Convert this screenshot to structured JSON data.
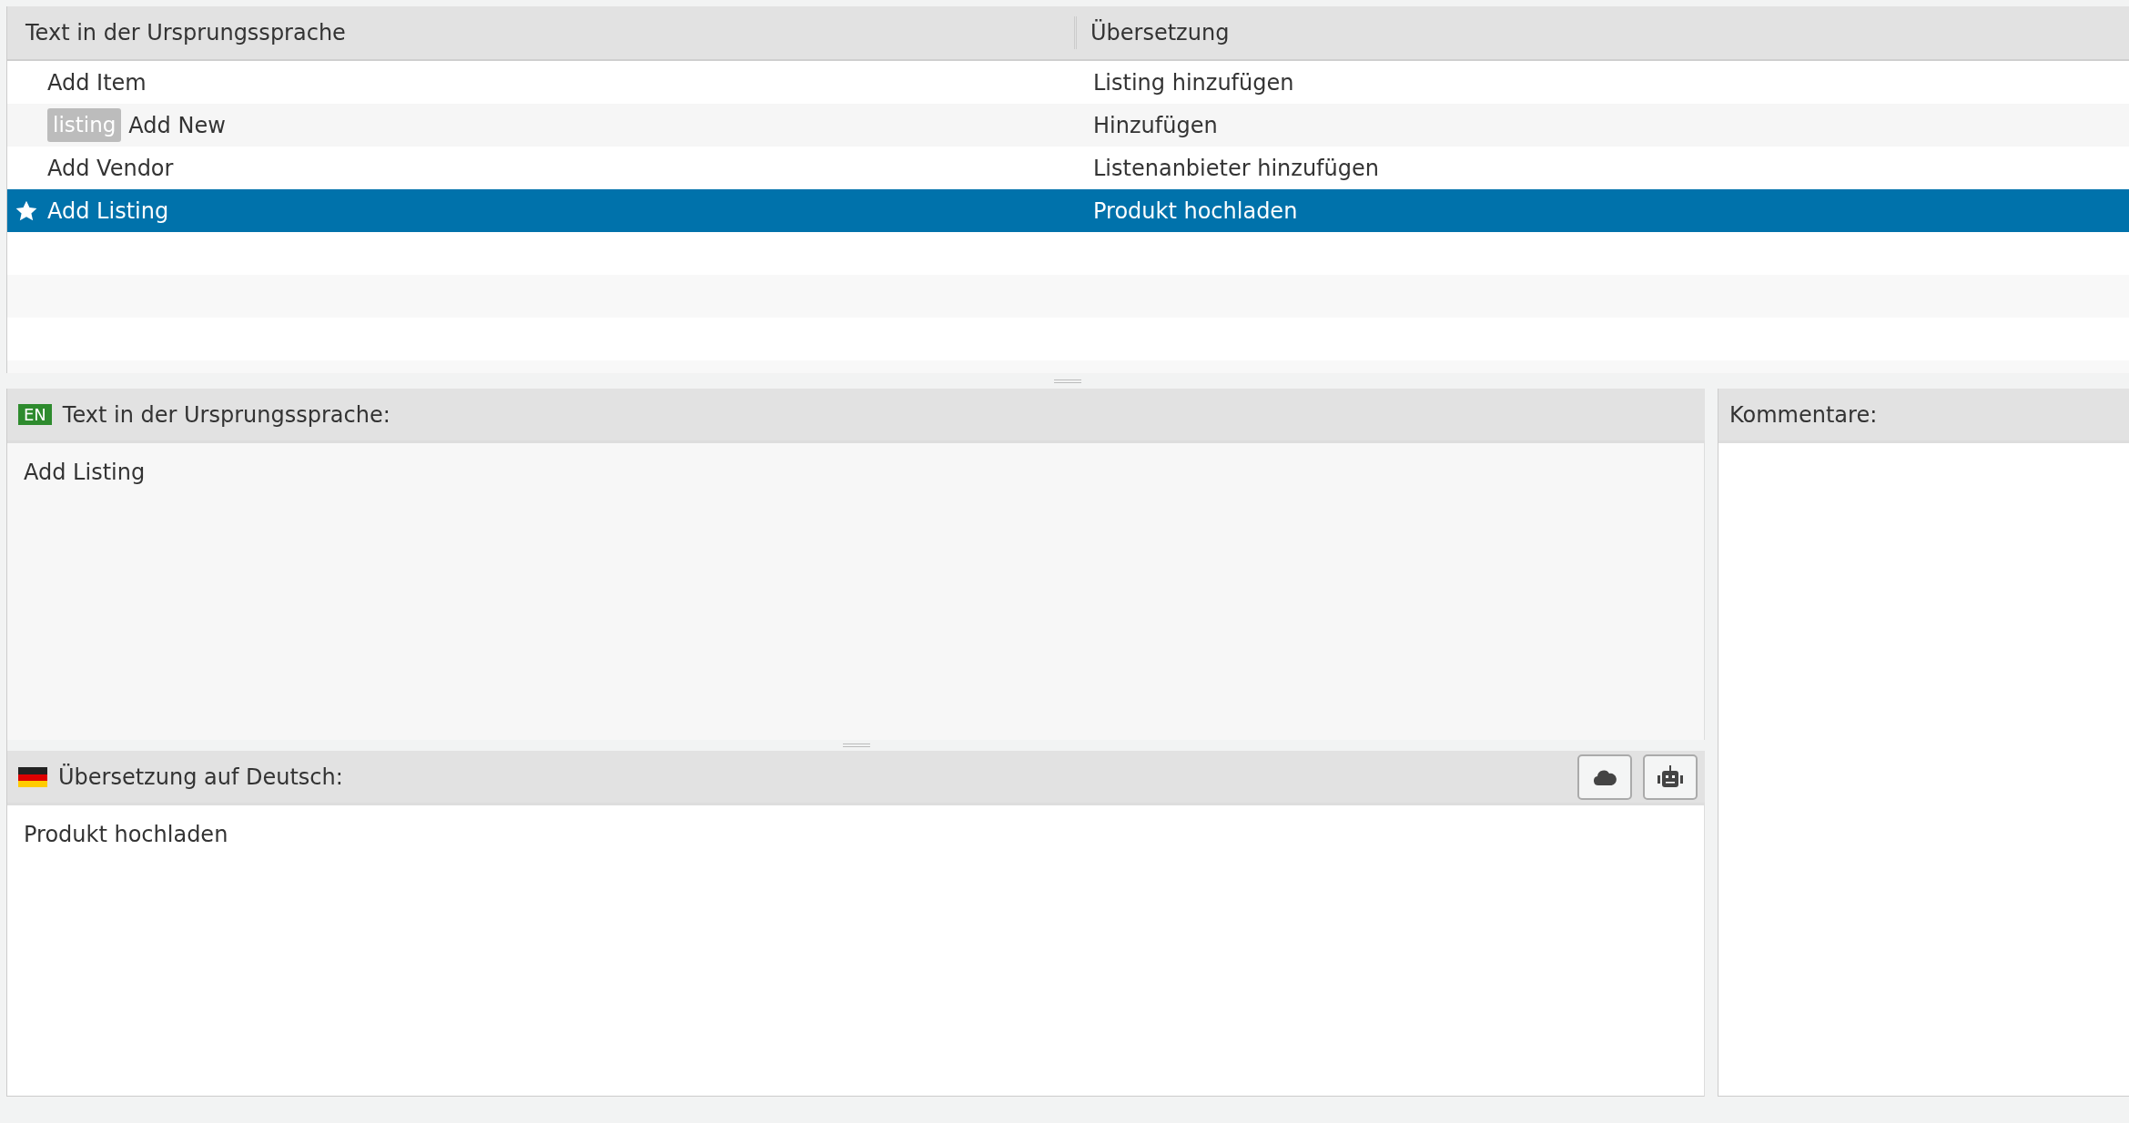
{
  "table": {
    "columns": [
      "Text in der Ursprungssprache",
      "Übersetzung"
    ],
    "rows": [
      {
        "source": "Add Item",
        "translation": "Listing hinzufügen",
        "starred": false,
        "selected": false
      },
      {
        "source": "Add New",
        "tag": "listing",
        "translation": "Hinzufügen",
        "starred": false,
        "selected": false
      },
      {
        "source": "Add Vendor",
        "translation": "Listenanbieter hinzufügen",
        "starred": false,
        "selected": false
      },
      {
        "source": "Add Listing",
        "translation": "Produkt hochladen",
        "starred": true,
        "selected": true
      }
    ]
  },
  "source_panel": {
    "language_badge": "EN",
    "title": "Text in der Ursprungssprache:",
    "text": "Add Listing"
  },
  "translation_panel": {
    "title": "Übersetzung auf Deutsch:",
    "text": "Produkt hochladen"
  },
  "comments_panel": {
    "title": "Kommentare:"
  }
}
